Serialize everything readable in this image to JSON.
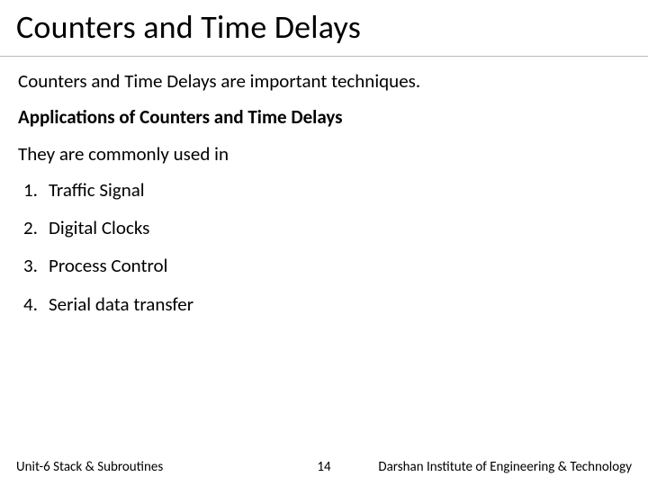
{
  "title": "Counters and Time Delays",
  "intro": "Counters and Time Delays are important techniques.",
  "apps_heading": "Applications of Counters and Time Delays",
  "commonly": "They are commonly used in",
  "items": [
    "Traffic Signal",
    "Digital Clocks",
    "Process Control",
    "Serial data transfer"
  ],
  "footer": {
    "left": "Unit-6 Stack & Subroutines",
    "page": "14",
    "right": "Darshan Institute of Engineering & Technology"
  }
}
